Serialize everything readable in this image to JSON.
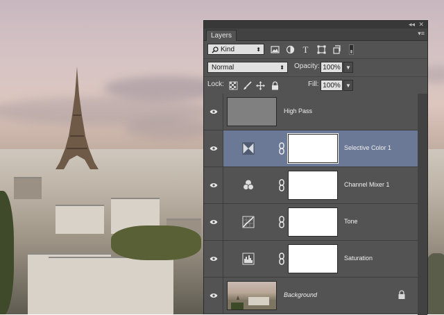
{
  "panel": {
    "title_buttons": [
      "◂◂",
      "✕"
    ],
    "tab": "Layers",
    "menu_glyph": "▾≡"
  },
  "filter": {
    "kind_label": "Kind",
    "icons": [
      "image-filter-icon",
      "adjustment-filter-icon",
      "type-filter-icon",
      "shape-filter-icon",
      "smart-object-filter-icon",
      "filter-toggle-icon"
    ]
  },
  "blend": {
    "mode": "Normal",
    "opacity_label": "Opacity:",
    "opacity": "100%"
  },
  "lock": {
    "label": "Lock:",
    "fill_label": "Fill:",
    "fill": "100%"
  },
  "layers": [
    {
      "name": "High Pass",
      "type": "smart-object"
    },
    {
      "name": "Selective Color 1",
      "type": "selective-color",
      "selected": true
    },
    {
      "name": "Channel Mixer 1",
      "type": "channel-mixer"
    },
    {
      "name": "Tone",
      "type": "curves"
    },
    {
      "name": "Saturation",
      "type": "levels"
    },
    {
      "name": "Background",
      "type": "background",
      "locked": true
    }
  ],
  "colors": {
    "panel": "#535353",
    "selected": "#6b7896"
  }
}
